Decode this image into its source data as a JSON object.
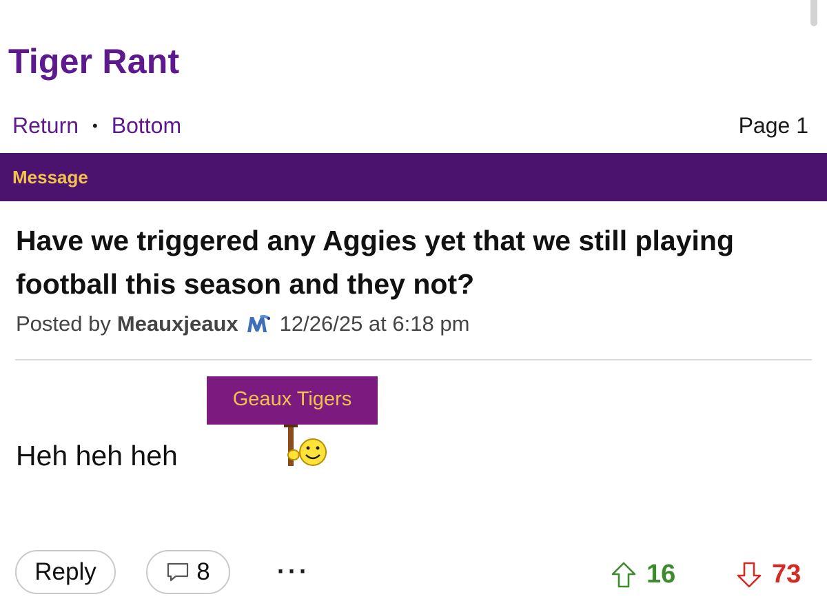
{
  "forum": {
    "title": "Tiger Rant"
  },
  "nav": {
    "return_label": "Return",
    "separator": "•",
    "bottom_label": "Bottom",
    "page_indicator": "Page 1"
  },
  "section_bar": {
    "label": "Message",
    "color": "#4b136e"
  },
  "post": {
    "title": "Have we triggered any Aggies yet that we still playing football this season and they not?",
    "posted_by_label": "Posted by",
    "author": "Meauxjeaux",
    "author_team_icon": "memphis-tigers-logo-icon",
    "date": "12/26/25 at 6:18 pm",
    "body_text": "Heh heh heh",
    "emoji_sign_text": "Geaux Tigers",
    "emoji_icon": "smiley-holding-sign-icon"
  },
  "actions": {
    "reply_label": "Reply",
    "comment_icon": "comment-bubble-icon",
    "comment_count": "8",
    "more_label": "···",
    "upvote_icon": "up-arrow-icon",
    "upvote_count": "16",
    "downvote_icon": "down-arrow-icon",
    "downvote_count": "73"
  },
  "colors": {
    "brand_purple": "#5d1a8e",
    "gold": "#f2c24e",
    "upvote_green": "#3d8a2f",
    "downvote_red": "#d42b24"
  }
}
